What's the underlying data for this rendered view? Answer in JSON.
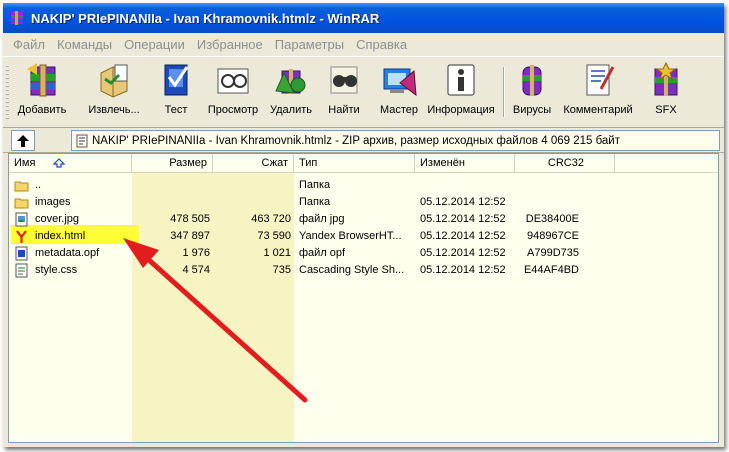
{
  "window": {
    "title": "NAKIP' PRIePINANIIa - Ivan Khramovnik.htmlz - WinRAR"
  },
  "menu": [
    "Файл",
    "Команды",
    "Операции",
    "Избранное",
    "Параметры",
    "Справка"
  ],
  "toolbar": [
    {
      "label": "Добавить",
      "icon": "add-archive-icon"
    },
    {
      "label": "Извлечь...",
      "icon": "extract-icon"
    },
    {
      "label": "Тест",
      "icon": "test-icon"
    },
    {
      "label": "Просмотр",
      "icon": "view-icon"
    },
    {
      "label": "Удалить",
      "icon": "delete-icon"
    },
    {
      "label": "Найти",
      "icon": "find-icon"
    },
    {
      "label": "Мастер",
      "icon": "wizard-icon"
    },
    {
      "label": "Информация",
      "icon": "info-icon"
    },
    {
      "label": "Вирусы",
      "icon": "virus-scan-icon"
    },
    {
      "label": "Комментарий",
      "icon": "comment-icon"
    },
    {
      "label": "SFX",
      "icon": "sfx-icon"
    }
  ],
  "address": {
    "text": "NAKIP' PRIePINANIIa - Ivan Khramovnik.htmlz - ZIP архив, размер исходных файлов 4 069 215 байт"
  },
  "columns": {
    "name": "Имя",
    "size": "Размер",
    "packed": "Сжат",
    "type": "Тип",
    "modified": "Изменён",
    "crc": "CRC32"
  },
  "files": [
    {
      "name": "..",
      "size": "",
      "packed": "",
      "type": "Папка",
      "modified": "",
      "crc": "",
      "icon": "folder-up-icon"
    },
    {
      "name": "images",
      "size": "",
      "packed": "",
      "type": "Папка",
      "modified": "05.12.2014 12:52",
      "crc": "",
      "icon": "folder-icon"
    },
    {
      "name": "cover.jpg",
      "size": "478 505",
      "packed": "463 720",
      "type": "файл jpg",
      "modified": "05.12.2014 12:52",
      "crc": "DE38400E",
      "icon": "image-file-icon"
    },
    {
      "name": "index.html",
      "size": "347 897",
      "packed": "73 590",
      "type": "Yandex BrowserHT...",
      "modified": "05.12.2014 12:52",
      "crc": "948967CE",
      "icon": "yandex-browser-icon"
    },
    {
      "name": "metadata.opf",
      "size": "1 976",
      "packed": "1 021",
      "type": "файл opf",
      "modified": "05.12.2014 12:52",
      "crc": "A799D735",
      "icon": "file-icon"
    },
    {
      "name": "style.css",
      "size": "4 574",
      "packed": "735",
      "type": "Cascading Style Sh...",
      "modified": "05.12.2014 12:52",
      "crc": "E44AF4BD",
      "icon": "css-file-icon"
    }
  ],
  "highlighted_row": "index.html",
  "colors": {
    "highlight": "#ffff33",
    "arrow": "#e21d1d",
    "titlebar": "#0054e3",
    "list_bg": "#ffffee"
  }
}
